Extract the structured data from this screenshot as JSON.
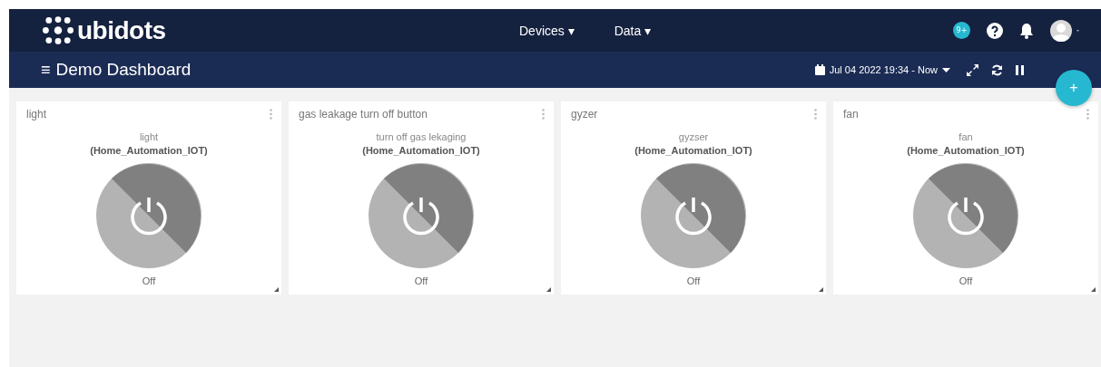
{
  "brand": "ubidots",
  "nav": [
    {
      "label": "Devices",
      "caret": "▾"
    },
    {
      "label": "Data",
      "caret": "▾"
    }
  ],
  "notifications_badge": "9+",
  "dashboard": {
    "menu_glyph": "≡",
    "title": "Demo Dashboard",
    "date_range": "Jul 04 2022 19:34 - Now",
    "add_glyph": "+"
  },
  "widgets": [
    {
      "title": "light",
      "variable": "light",
      "device": "(Home_Automation_IOT)",
      "on": false,
      "status": "Off"
    },
    {
      "title": "gas leakage turn off button",
      "variable": "turn off gas lekaging",
      "device": "(Home_Automation_IOT)",
      "on": false,
      "status": "Off"
    },
    {
      "title": "gyzer",
      "variable": "gyzser",
      "device": "(Home_Automation_IOT)",
      "on": false,
      "status": "Off"
    },
    {
      "title": "fan",
      "variable": "fan",
      "device": "(Home_Automation_IOT)",
      "on": false,
      "status": "Off"
    }
  ]
}
